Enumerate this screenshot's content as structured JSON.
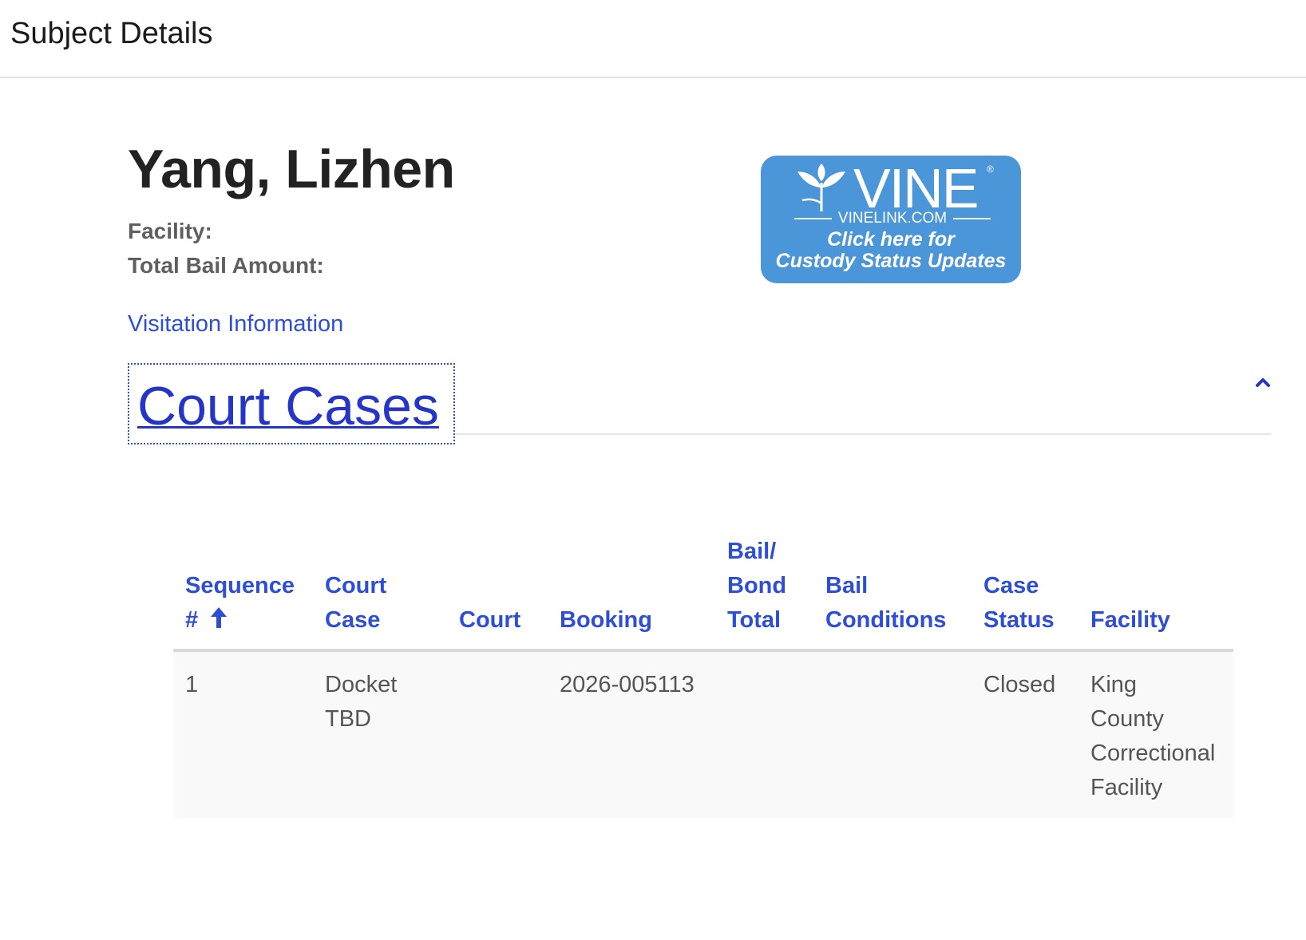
{
  "page": {
    "title": "Subject Details"
  },
  "subject": {
    "name": "Yang, Lizhen",
    "facility_label": "Facility:",
    "bail_label": "Total Bail Amount:",
    "visitation_link": "Visitation Information"
  },
  "vine_banner": {
    "wordmark": "VINE",
    "registered": "®",
    "url": "VINELINK.COM",
    "cta_line1": "Click here for",
    "cta_line2": "Custody Status Updates",
    "color": "#4a96d9",
    "icon": "vine-leaf-icon"
  },
  "court_cases": {
    "title": "Court Cases",
    "toggle_icon": "chevron-up-icon",
    "accent_color": "#2f4ed6",
    "columns": {
      "sequence_line1": "Sequence",
      "sequence_line2": "#",
      "sequence_sort_icon": "arrow-up-icon",
      "court_case_line1": "Court",
      "court_case_line2": "Case",
      "court": "Court",
      "booking": "Booking",
      "bail_line1": "Bail/",
      "bail_line2": "Bond",
      "bail_line3": "Total",
      "conditions_line1": "Bail",
      "conditions_line2": "Conditions",
      "status_line1": "Case",
      "status_line2": "Status",
      "facility": "Facility"
    },
    "rows": [
      {
        "sequence": "1",
        "court_case_line1": "Docket",
        "court_case_line2": "TBD",
        "court": "",
        "booking": "2026-005113",
        "bail_total": "",
        "bail_conditions": "",
        "case_status": "Closed",
        "facility_line1": "King",
        "facility_line2": "County",
        "facility_line3": "Correctional",
        "facility_line4": "Facility"
      }
    ]
  }
}
